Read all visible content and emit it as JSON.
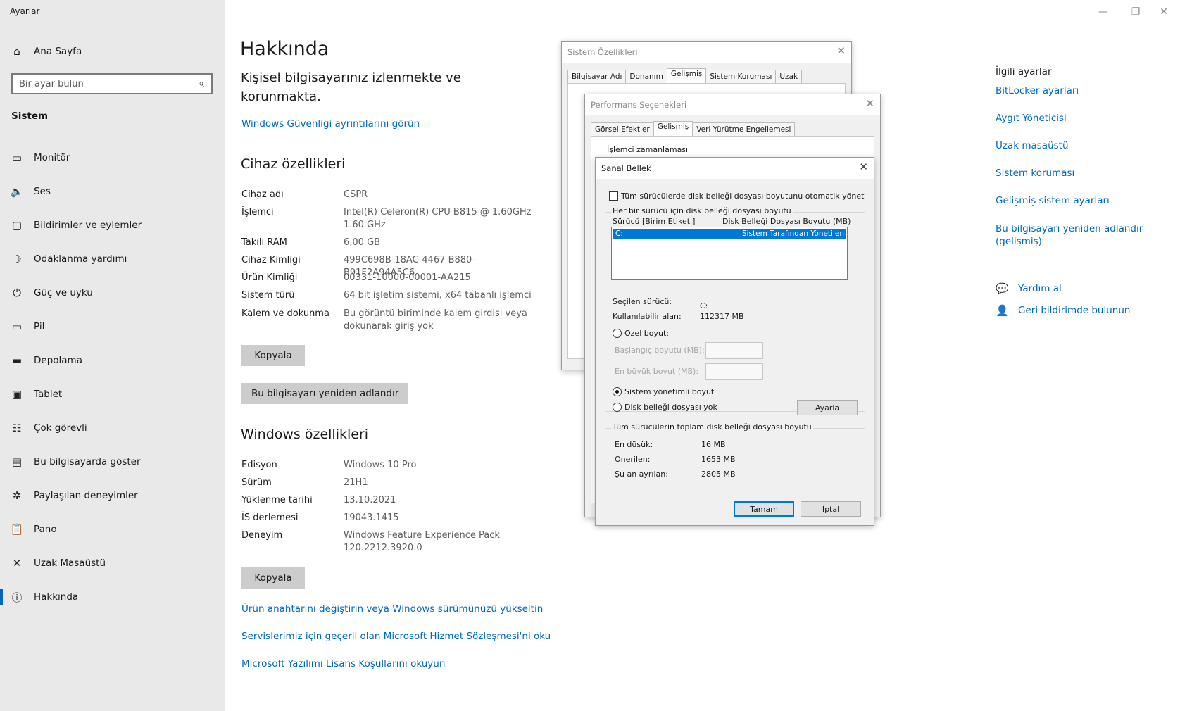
{
  "window": {
    "title": "Ayarlar",
    "minimize": "—",
    "maximize": "❐",
    "close": "✕"
  },
  "sidebar": {
    "home": "Ana Sayfa",
    "search_placeholder": "Bir ayar bulun",
    "section": "Sistem",
    "items": [
      {
        "label": "Monitör",
        "icon": "monitor-icon"
      },
      {
        "label": "Ses",
        "icon": "speaker-icon"
      },
      {
        "label": "Bildirimler ve eylemler",
        "icon": "notification-icon"
      },
      {
        "label": "Odaklanma yardımı",
        "icon": "moon-icon"
      },
      {
        "label": "Güç ve uyku",
        "icon": "power-icon"
      },
      {
        "label": "Pil",
        "icon": "battery-icon"
      },
      {
        "label": "Depolama",
        "icon": "storage-icon"
      },
      {
        "label": "Tablet",
        "icon": "tablet-icon"
      },
      {
        "label": "Çok görevli",
        "icon": "multitask-icon"
      },
      {
        "label": "Bu bilgisayarda göster",
        "icon": "project-icon"
      },
      {
        "label": "Paylaşılan deneyimler",
        "icon": "share-icon"
      },
      {
        "label": "Pano",
        "icon": "clipboard-icon"
      },
      {
        "label": "Uzak Masaüstü",
        "icon": "remote-icon"
      },
      {
        "label": "Hakkında",
        "icon": "info-icon"
      }
    ]
  },
  "main": {
    "title": "Hakkında",
    "status": "Kişisel bilgisayarınız izlenmekte ve korunmakta.",
    "security_link": "Windows Güvenliği ayrıntılarını görün",
    "device": {
      "heading": "Cihaz özellikleri",
      "rows": [
        {
          "k": "Cihaz adı",
          "v": "CSPR"
        },
        {
          "k": "İşlemci",
          "v": "Intel(R) Celeron(R) CPU B815 @ 1.60GHz   1.60 GHz"
        },
        {
          "k": "Takılı RAM",
          "v": "6,00 GB"
        },
        {
          "k": "Cihaz Kimliği",
          "v": "499C698B-18AC-4467-B880-B91F2A94A5C6"
        },
        {
          "k": "Ürün Kimliği",
          "v": "00331-10000-00001-AA215"
        },
        {
          "k": "Sistem türü",
          "v": "64 bit işletim sistemi, x64 tabanlı işlemci"
        },
        {
          "k": "Kalem ve dokunma",
          "v": "Bu görüntü biriminde kalem girdisi veya dokunarak giriş yok"
        }
      ],
      "copy": "Kopyala",
      "rename": "Bu bilgisayarı yeniden adlandır"
    },
    "windows": {
      "heading": "Windows özellikleri",
      "rows": [
        {
          "k": "Edisyon",
          "v": "Windows 10 Pro"
        },
        {
          "k": "Sürüm",
          "v": "21H1"
        },
        {
          "k": "Yüklenme tarihi",
          "v": "13.10.2021"
        },
        {
          "k": "İS derlemesi",
          "v": "19043.1415"
        },
        {
          "k": "Deneyim",
          "v": "Windows Feature Experience Pack 120.2212.3920.0"
        }
      ],
      "copy": "Kopyala"
    },
    "links": [
      "Ürün anahtarını değiştirin veya Windows sürümünüzü yükseltin",
      "Servislerimiz için geçerli olan Microsoft Hizmet Sözleşmesi'ni oku",
      "Microsoft Yazılımı Lisans Koşullarını okuyun"
    ]
  },
  "related": {
    "heading": "İlgili ayarlar",
    "links": [
      "BitLocker ayarları",
      "Aygıt Yöneticisi",
      "Uzak masaüstü",
      "Sistem koruması",
      "Gelişmiş sistem ayarları",
      "Bu bilgisayarı yeniden adlandır (gelişmiş)"
    ],
    "help": "Yardım al",
    "feedback": "Geri bildirimde bulunun"
  },
  "sys_props": {
    "title": "Sistem Özellikleri",
    "tabs": [
      "Bilgisayar Adı",
      "Donanım",
      "Gelişmiş",
      "Sistem Koruması",
      "Uzak"
    ],
    "active_tab": 2
  },
  "perf": {
    "title": "Performans Seçenekleri",
    "tabs": [
      "Görsel Efektler",
      "Gelişmiş",
      "Veri Yürütme Engellemesi"
    ],
    "active_tab": 1,
    "group": "İşlemci zamanlaması"
  },
  "vm": {
    "title": "Sanal Bellek",
    "auto_manage": "Tüm sürücülerde disk belleği dosyası boyutunu otomatik yönet",
    "auto_checked": false,
    "per_drive_label": "Her bir sürücü için disk belleği dosyası boyutu",
    "col_drive": "Sürücü  [Birim Etiketi]",
    "col_size": "Disk Belleği Dosyası Boyutu (MB)",
    "selected_row": {
      "drive": "C:",
      "size": "Sistem Tarafından Yönetilen"
    },
    "selected_drive_label": "Seçilen sürücü:",
    "selected_drive": "C:",
    "free_label": "Kullanılabilir alan:",
    "free": "112317 MB",
    "custom": "Özel boyut:",
    "initial": "Başlangıç boyutu (MB):",
    "max": "En büyük boyut (MB):",
    "system_managed": "Sistem yönetimli boyut",
    "no_paging": "Disk belleği dosyası yok",
    "set_btn": "Ayarla",
    "totals_label": "Tüm sürücülerin toplam disk belleği dosyası boyutu",
    "min_label": "En düşük:",
    "min": "16 MB",
    "rec_label": "Önerilen:",
    "rec": "1653 MB",
    "cur_label": "Şu an ayrılan:",
    "cur": "2805 MB",
    "ok": "Tamam",
    "cancel": "İptal"
  }
}
